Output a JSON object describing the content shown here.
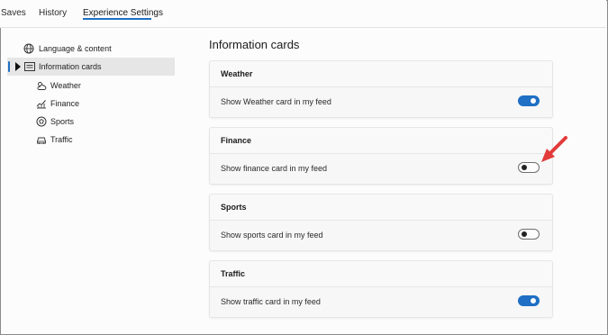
{
  "tabs": [
    "Saves",
    "History",
    "Experience Settings"
  ],
  "sidebar": {
    "items": [
      {
        "label": "Language & content",
        "icon": "globe-icon"
      },
      {
        "label": "Information cards",
        "icon": "cards-icon"
      },
      {
        "label": "Weather",
        "icon": "weather-icon"
      },
      {
        "label": "Finance",
        "icon": "finance-icon"
      },
      {
        "label": "Sports",
        "icon": "sports-icon"
      },
      {
        "label": "Traffic",
        "icon": "traffic-icon"
      }
    ]
  },
  "main": {
    "title": "Information cards",
    "cards": [
      {
        "title": "Weather",
        "setting": "Show Weather card in my feed",
        "enabled": true
      },
      {
        "title": "Finance",
        "setting": "Show finance card in my feed",
        "enabled": false
      },
      {
        "title": "Sports",
        "setting": "Show sports card in my feed",
        "enabled": false
      },
      {
        "title": "Traffic",
        "setting": "Show traffic card in my feed",
        "enabled": true
      }
    ]
  },
  "colors": {
    "accent": "#1f6fc4",
    "annotation_arrow": "#e23b3b"
  }
}
